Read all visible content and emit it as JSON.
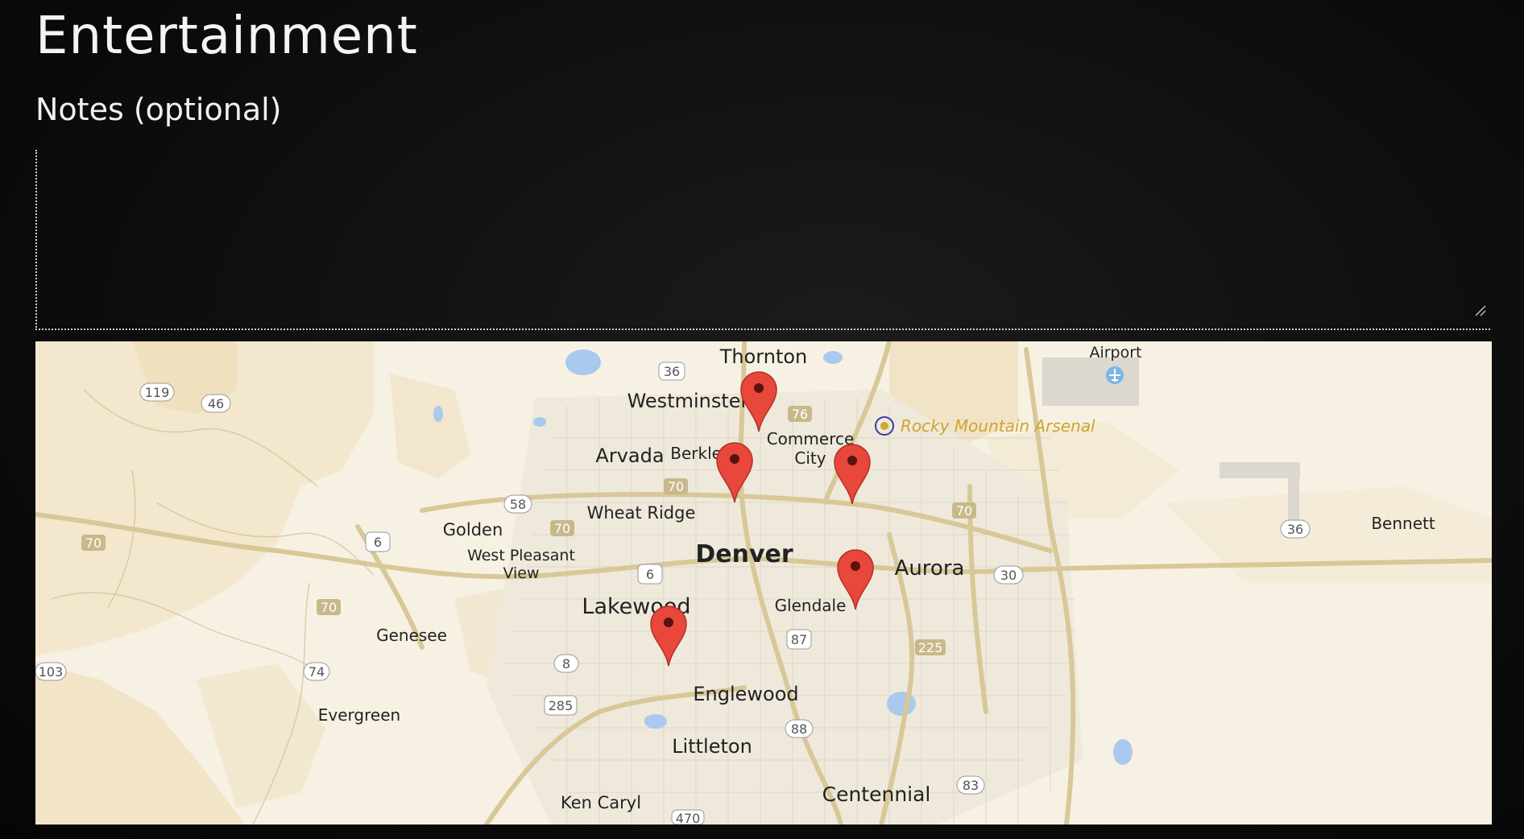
{
  "page": {
    "title": "Entertainment",
    "notes_label": "Notes (optional)",
    "notes_value": "",
    "notes_placeholder": ""
  },
  "map": {
    "places": {
      "thornton": "Thornton",
      "westminster": "Westminster",
      "arvada": "Arvada",
      "berkley": "Berkley",
      "commerce_city_1": "Commerce",
      "commerce_city_2": "City",
      "rocky_mountain_arsenal": "Rocky Mountain Arsenal",
      "airport": "Airport",
      "wheat_ridge": "Wheat Ridge",
      "golden": "Golden",
      "west_pleasant_view_1": "West Pleasant",
      "west_pleasant_view_2": "View",
      "denver": "Denver",
      "aurora": "Aurora",
      "bennett": "Bennett",
      "lakewood": "Lakewood",
      "glendale": "Glendale",
      "genesee": "Genesee",
      "englewood": "Englewood",
      "evergreen": "Evergreen",
      "littleton": "Littleton",
      "ken_caryl": "Ken Caryl",
      "centennial": "Centennial"
    },
    "shields": {
      "s119": "119",
      "s46": "46",
      "s36a": "36",
      "s76": "76",
      "s70a": "70",
      "s58": "58",
      "s70b": "70",
      "s6a": "6",
      "s70c": "70",
      "s6b": "6",
      "s70d": "70",
      "s30": "30",
      "s36b": "36",
      "s70e": "70",
      "s87": "87",
      "s225": "225",
      "s103": "103",
      "s74": "74",
      "s8": "8",
      "s285": "285",
      "s88": "88",
      "s83": "83",
      "s470": "470"
    },
    "marker_icon": "map-pin-icon",
    "marker_color": "#e8473b"
  }
}
